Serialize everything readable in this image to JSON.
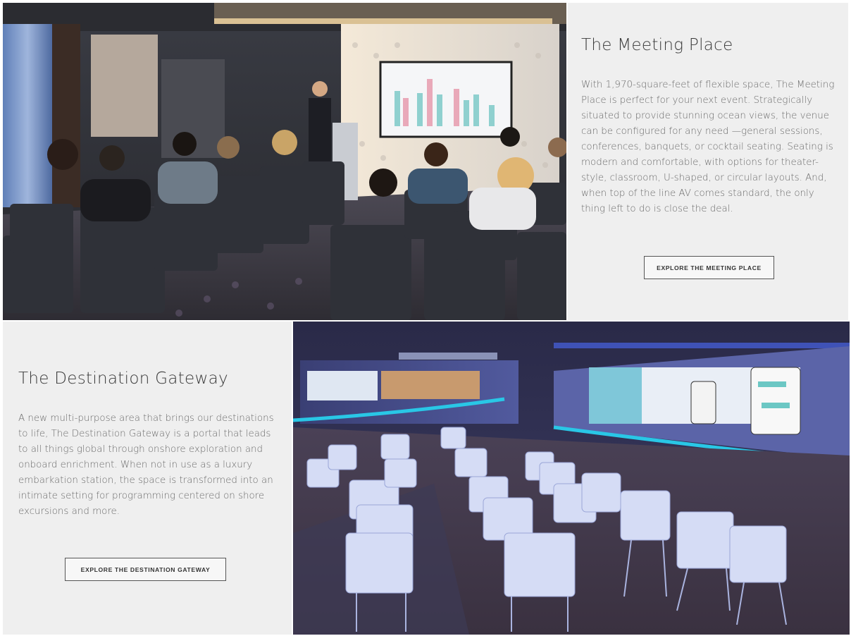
{
  "meeting_place": {
    "title": "The Meeting Place",
    "description": "With 1,970-square-feet of flexible space, The Meeting Place is perfect for your next event. Strategically situated to provide stunning ocean views, the venue can be configured for any need —general sessions, conferences, banquets, or cocktail seating. Seating is modern and comfortable, with options for theater-style, classroom, U-shaped, or circular layouts. And, when top of the line AV comes standard, the only thing left to do is close the deal.",
    "cta_label": "EXPLORE THE MEETING PLACE",
    "photo_name": "meeting-room-presentation-photo"
  },
  "destination_gateway": {
    "title": "The Destination Gateway",
    "description": "A new multi-purpose area that brings our destinations to life, The Destination Gateway is a portal that leads to all things global through onshore exploration and onboard enrichment. When not in use as a luxury embarkation station, the space is transformed into an intimate setting for programming centered on shore excursions and more.",
    "cta_label": "EXPLORE THE DESTINATION GATEWAY",
    "photo_name": "destination-gateway-venue-photo"
  },
  "colors": {
    "panel_bg": "#efefef",
    "title_text": "#3a3a3a",
    "body_text": "#6b6b6b",
    "button_border": "#555555"
  }
}
